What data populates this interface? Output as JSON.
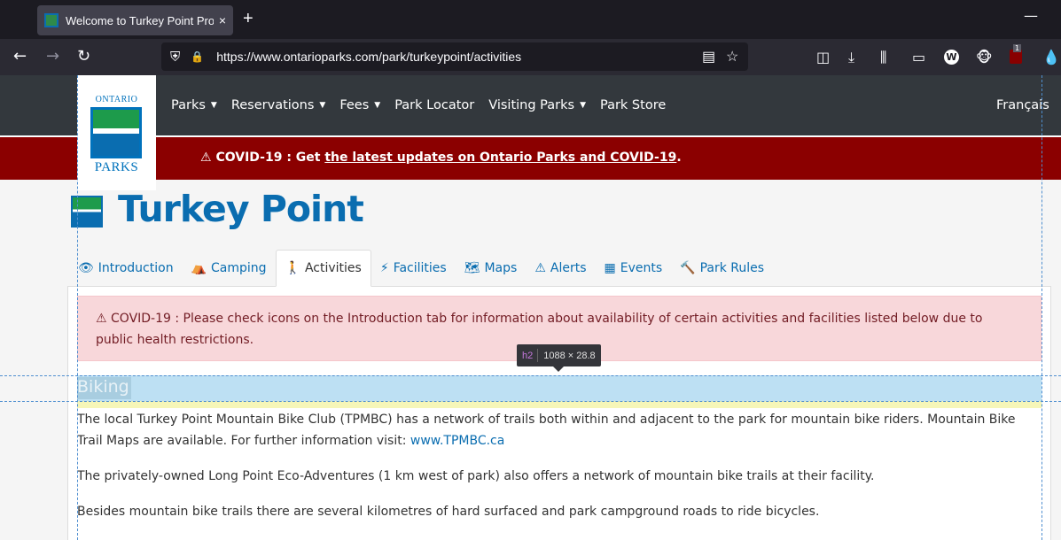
{
  "browser": {
    "tab_title": "Welcome to Turkey Point Provin",
    "tab_close": "×",
    "new_tab": "+",
    "minimize": "—",
    "url": "https://www.ontarioparks.com/park/turkeypoint/activities",
    "back": "←",
    "forward": "→",
    "reload": "↻",
    "shield": "⛨",
    "lock": "🔒",
    "reader": "▤",
    "star": "☆",
    "w_badge": "W",
    "ublock_count": "1"
  },
  "site": {
    "logo_top": "ONTARIO",
    "logo_bottom": "PARKS",
    "nav": [
      "Parks",
      "Reservations",
      "Fees",
      "Park Locator",
      "Visiting Parks",
      "Park Store"
    ],
    "nav_has_caret": [
      true,
      true,
      true,
      false,
      true,
      false
    ],
    "caret": "▼",
    "language": "Français",
    "covid_prefix": "COVID-19 : Get ",
    "covid_link": "the latest updates on Ontario Parks and COVID-19",
    "covid_suffix": ".",
    "warning_icon": "⚠"
  },
  "park": {
    "title": "Turkey Point"
  },
  "tabs": [
    {
      "label": "Introduction",
      "icon": "👁",
      "active": false
    },
    {
      "label": "Camping",
      "icon": "⛺",
      "active": false
    },
    {
      "label": "Activities",
      "icon": "🚶",
      "active": true
    },
    {
      "label": "Facilities",
      "icon": "⚡",
      "active": false
    },
    {
      "label": "Maps",
      "icon": "🗺",
      "active": false
    },
    {
      "label": "Alerts",
      "icon": "⚠",
      "active": false
    },
    {
      "label": "Events",
      "icon": "▦",
      "active": false
    },
    {
      "label": "Park Rules",
      "icon": "🔨",
      "active": false
    }
  ],
  "alert": {
    "icon": "⚠",
    "text": "COVID-19 : Please check icons on the Introduction tab for information about availability of certain activities and facilities listed below due to public health restrictions."
  },
  "inspector": {
    "tag": "h2",
    "size": "1088 × 28.8"
  },
  "section": {
    "heading": "Biking",
    "p1_text": "The local Turkey Point Mountain Bike Club (TPMBC) has a network of trails both within and adjacent to the park for mountain bike riders. Mountain Bike Trail Maps are available.  For further information visit: ",
    "p1_link": "www.TPMBC.ca",
    "p2": "The privately-owned Long Point Eco-Adventures (1 km west of park) also offers a network of mountain bike trails at their facility.",
    "p3": "Besides mountain bike trails there are several kilometres of hard surfaced and park campground roads to ride bicycles."
  },
  "colors": {
    "brand_blue": "#0a6db0",
    "covid_red": "#8b0000",
    "header_dark": "#33383d",
    "alert_bg": "#f8d7da",
    "alert_text": "#721c24"
  }
}
